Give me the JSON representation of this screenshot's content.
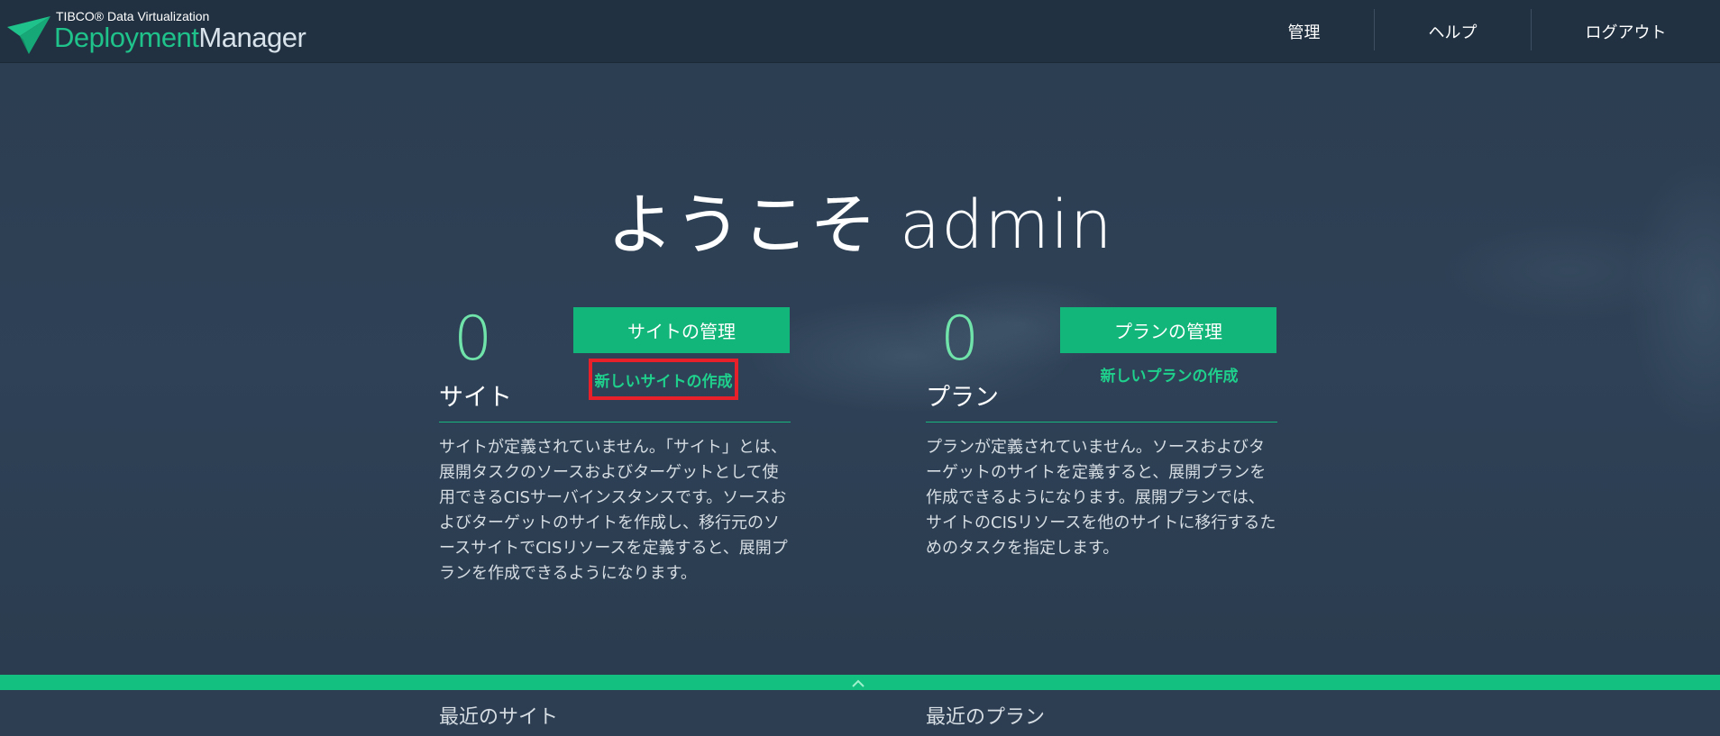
{
  "header": {
    "logo_small": "TIBCO® Data Virtualization",
    "logo_word1": "Deployment",
    "logo_word2": "Manager",
    "nav": [
      {
        "label": "管理"
      },
      {
        "label": "ヘルプ"
      },
      {
        "label": "ログアウト"
      }
    ]
  },
  "welcome": "ようこそ admin",
  "sites": {
    "count": "0",
    "manage_label": "サイトの管理",
    "create_label": "新しいサイトの作成",
    "title": "サイト",
    "description": "サイトが定義されていません。「サイト」とは、展開タスクのソースおよびターゲットとして使用できるCISサーバインスタンスです。ソースおよびターゲットのサイトを作成し、移行元のソースサイトでCISリソースを定義すると、展開プランを作成できるようになります。"
  },
  "plans": {
    "count": "0",
    "manage_label": "プランの管理",
    "create_label": "新しいプランの作成",
    "title": "プラン",
    "description": "プランが定義されていません。ソースおよびターゲットのサイトを定義すると、展開プランを作成できるようになります。展開プランでは、サイトのCISリソースを他のサイトに移行するためのタスクを指定します。"
  },
  "recent": {
    "sites_label": "最近のサイト",
    "plans_label": "最近のプラン"
  },
  "colors": {
    "accent": "#13b67a",
    "highlight": "#e8202a",
    "header_bg": "#213141"
  }
}
